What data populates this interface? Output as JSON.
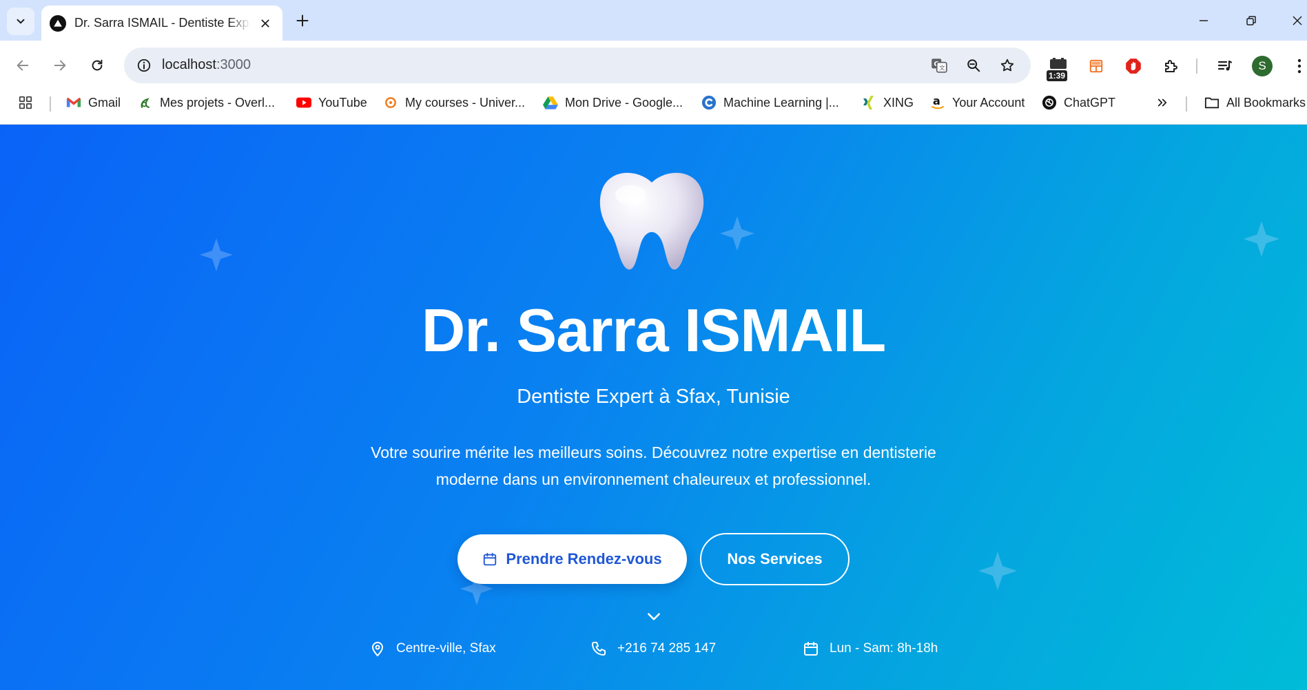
{
  "browser": {
    "tab_title": "Dr. Sarra ISMAIL - Dentiste Expert à Sfax",
    "url_host": "localhost",
    "url_port": ":3000",
    "extension_badge": "1:39",
    "profile_initial": "S",
    "bookmarks": [
      {
        "label": "Gmail",
        "icon": "gmail-icon"
      },
      {
        "label": "Mes projets - Overl...",
        "icon": "overleaf-icon"
      },
      {
        "label": "YouTube",
        "icon": "youtube-icon"
      },
      {
        "label": "My courses - Univer...",
        "icon": "moodle-icon"
      },
      {
        "label": "Mon Drive - Google...",
        "icon": "google-drive-icon"
      },
      {
        "label": "Machine Learning |...",
        "icon": "coursera-icon"
      },
      {
        "label": "XING",
        "icon": "xing-icon"
      },
      {
        "label": "Your Account",
        "icon": "amazon-icon"
      },
      {
        "label": "ChatGPT",
        "icon": "chatgpt-icon"
      }
    ],
    "all_bookmarks": "All Bookmarks"
  },
  "hero": {
    "title": "Dr. Sarra ISMAIL",
    "subtitle": "Dentiste Expert à Sfax, Tunisie",
    "description": "Votre sourire mérite les meilleurs soins. Découvrez notre expertise en dentisterie moderne dans un environnement chaleureux et professionnel.",
    "primary_button": "Prendre Rendez-vous",
    "secondary_button": "Nos Services"
  },
  "info": {
    "location": "Centre-ville, Sfax",
    "phone": "+216 74 285 147",
    "hours": "Lun - Sam: 8h-18h"
  },
  "colors": {
    "hero_gradient_start": "#0a63f7",
    "hero_gradient_end": "#00bcd8",
    "primary_button_text": "#1f57d6",
    "tabstrip": "#d3e3fd"
  }
}
